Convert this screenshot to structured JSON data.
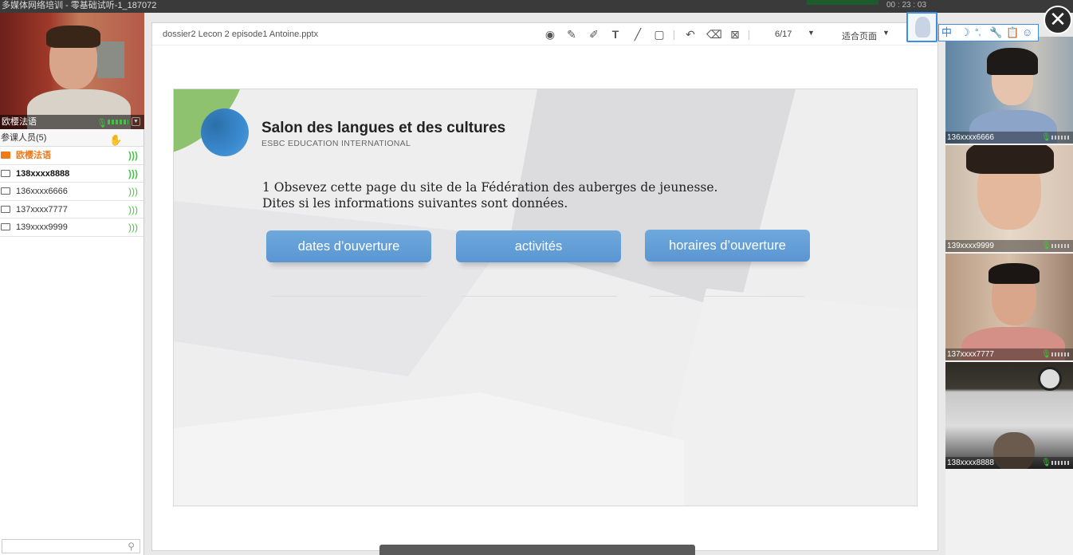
{
  "window": {
    "title": "多媒体网络培训 - 零基础试听-1_187072",
    "timer": "00 : 23 : 03"
  },
  "self_cam": {
    "name": "欧樱法语"
  },
  "members": {
    "header": "参课人员(5)",
    "items": [
      {
        "label": "欧樱法语",
        "role": "teacher"
      },
      {
        "label": "138xxxx8888",
        "role": "student"
      },
      {
        "label": "136xxxx6666",
        "role": "student"
      },
      {
        "label": "137xxxx7777",
        "role": "student"
      },
      {
        "label": "139xxxx9999",
        "role": "student"
      }
    ]
  },
  "viewer": {
    "filename": "dossier2 Lecon 2 episode1 Antoine.pptx",
    "page": "6/17",
    "fit": "适合页面",
    "tools": [
      "record-icon",
      "pen-icon",
      "highlighter-icon",
      "text-tool-icon",
      "line-tool-icon",
      "rectangle-tool-icon",
      "undo-icon",
      "eraser-icon",
      "clear-icon"
    ]
  },
  "slide": {
    "title": "Salon des langues et des cultures",
    "subtitle": "ESBC EDUCATION INTERNATIONAL",
    "instruction": "1 Obsevez cette page du site de la Fédération des auberges de jeunesse.\nDites si les informations suivantes sont données.",
    "options": [
      "dates d’ouverture",
      "activités",
      "horaires d’ouverture"
    ]
  },
  "cams": [
    {
      "name": "136xxxx6666"
    },
    {
      "name": "139xxxx9999"
    },
    {
      "name": "137xxxx7777"
    },
    {
      "name": "138xxxx8888"
    }
  ],
  "ime": {
    "mode": "中"
  },
  "colors": {
    "accent": "#5a96d2",
    "teacher": "#f07a1a",
    "mic": "#3fc63f",
    "brand_green": "#8ec26e"
  }
}
